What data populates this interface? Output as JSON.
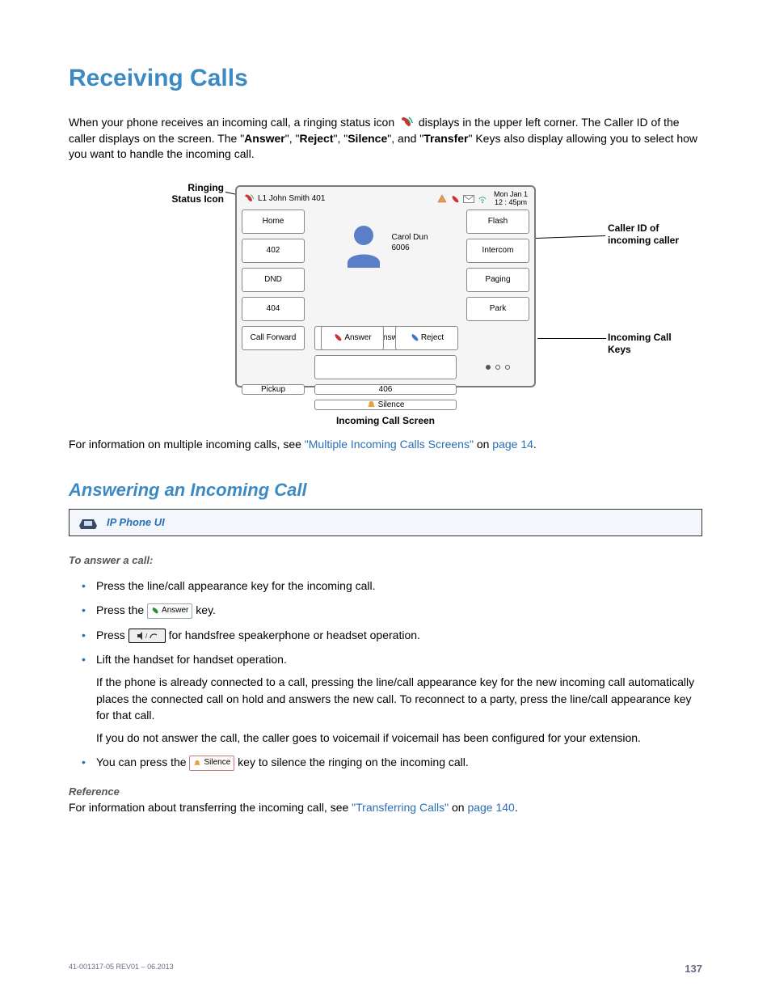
{
  "title": "Receiving Calls",
  "intro": {
    "pre": "When your phone receives an incoming call, a ringing status icon ",
    "post1": " displays in the upper left corner. The Caller ID of the caller displays on the screen. The \"",
    "k1": "Answer",
    "sep": "\", \"",
    "k2": "Reject",
    "k3": "Silence",
    "and": "\", and \"",
    "k4": "Transfer",
    "tail": "\" Keys also display allowing you to select how you want to handle the incoming call."
  },
  "callouts": {
    "left_l1": "Ringing",
    "left_l2": "Status Icon",
    "right1_l1": "Caller ID of",
    "right1_l2": "incoming caller",
    "right2_l1": "Incoming Call",
    "right2_l2": "Keys"
  },
  "screen": {
    "line_label": "L1 John Smith 401",
    "date": "Mon Jan 1",
    "time": "12 : 45pm",
    "left_keys": [
      "Home",
      "402",
      "DND",
      "404",
      "Call Forward",
      "406"
    ],
    "right_keys": [
      "Flash",
      "Intercom",
      "Paging",
      "Park",
      "Pickup"
    ],
    "answer": "Answer",
    "reject": "Reject",
    "silence": "Silence",
    "caller_name": "Carol Dun",
    "caller_num": "6006"
  },
  "figure_caption": "Incoming Call Screen",
  "xref": {
    "pre": "For information on multiple incoming calls, see ",
    "link": "\"Multiple Incoming Calls Screens\"",
    "mid": " on ",
    "page": "page 14",
    "post": "."
  },
  "sub_heading": "Answering an Incoming Call",
  "ui_label": "IP Phone UI",
  "proc_title": "To answer a call:",
  "steps": {
    "s1": "Press the line/call appearance key for the incoming call.",
    "s2a": "Press the ",
    "s2badge": "Answer",
    "s2b": " key.",
    "s3a": "Press ",
    "s3b": " for handsfree speakerphone or headset operation.",
    "s4": "Lift the handset for handset operation.",
    "note1": "If the phone is already connected to a call, pressing the line/call appearance key for the new incoming call automatically places the connected call on hold and answers the new call. To reconnect to a party, press the line/call appearance key for that call.",
    "note2": "If you do not answer the call, the caller goes to voicemail if voicemail has been configured for your extension.",
    "s5a": "You can press the ",
    "s5badge": "Silence",
    "s5b": " key to silence the ringing on the incoming call."
  },
  "reference": {
    "head": "Reference",
    "pre": "For information about transferring the incoming call, see ",
    "link": "\"Transferring Calls\"",
    "mid": " on ",
    "page": "page 140",
    "post": "."
  },
  "footer": {
    "doc": "41-001317-05 REV01 – 06.2013",
    "page": "137"
  }
}
